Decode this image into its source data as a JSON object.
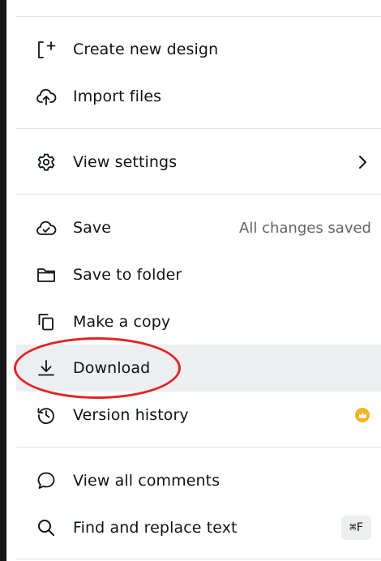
{
  "menu": {
    "create_new_design": {
      "label": "Create new design",
      "icon": "add-file-icon"
    },
    "import_files": {
      "label": "Import files",
      "icon": "cloud-upload-icon"
    },
    "view_settings": {
      "label": "View settings",
      "icon": "gear-icon",
      "submenu_icon": "chevron-right-icon"
    },
    "save": {
      "label": "Save",
      "icon": "cloud-check-icon",
      "status": "All changes saved"
    },
    "save_to_folder": {
      "label": "Save to folder",
      "icon": "folder-icon"
    },
    "make_a_copy": {
      "label": "Make a copy",
      "icon": "copy-icon"
    },
    "download": {
      "label": "Download",
      "icon": "download-icon",
      "highlighted": true
    },
    "version_history": {
      "label": "Version history",
      "icon": "history-icon",
      "badge_icon": "crown-icon"
    },
    "view_all_comments": {
      "label": "View all comments",
      "icon": "comment-icon"
    },
    "find_and_replace": {
      "label": "Find and replace text",
      "icon": "search-icon",
      "shortcut": "⌘F"
    }
  },
  "colors": {
    "text": "#0e1318",
    "muted_text": "#5f6368",
    "divider": "#dfe1e5",
    "hover_background": "#eceef0",
    "crown_badge": "#f5b524",
    "annotation_circle": "#e02424",
    "left_edge": "#16181b"
  }
}
